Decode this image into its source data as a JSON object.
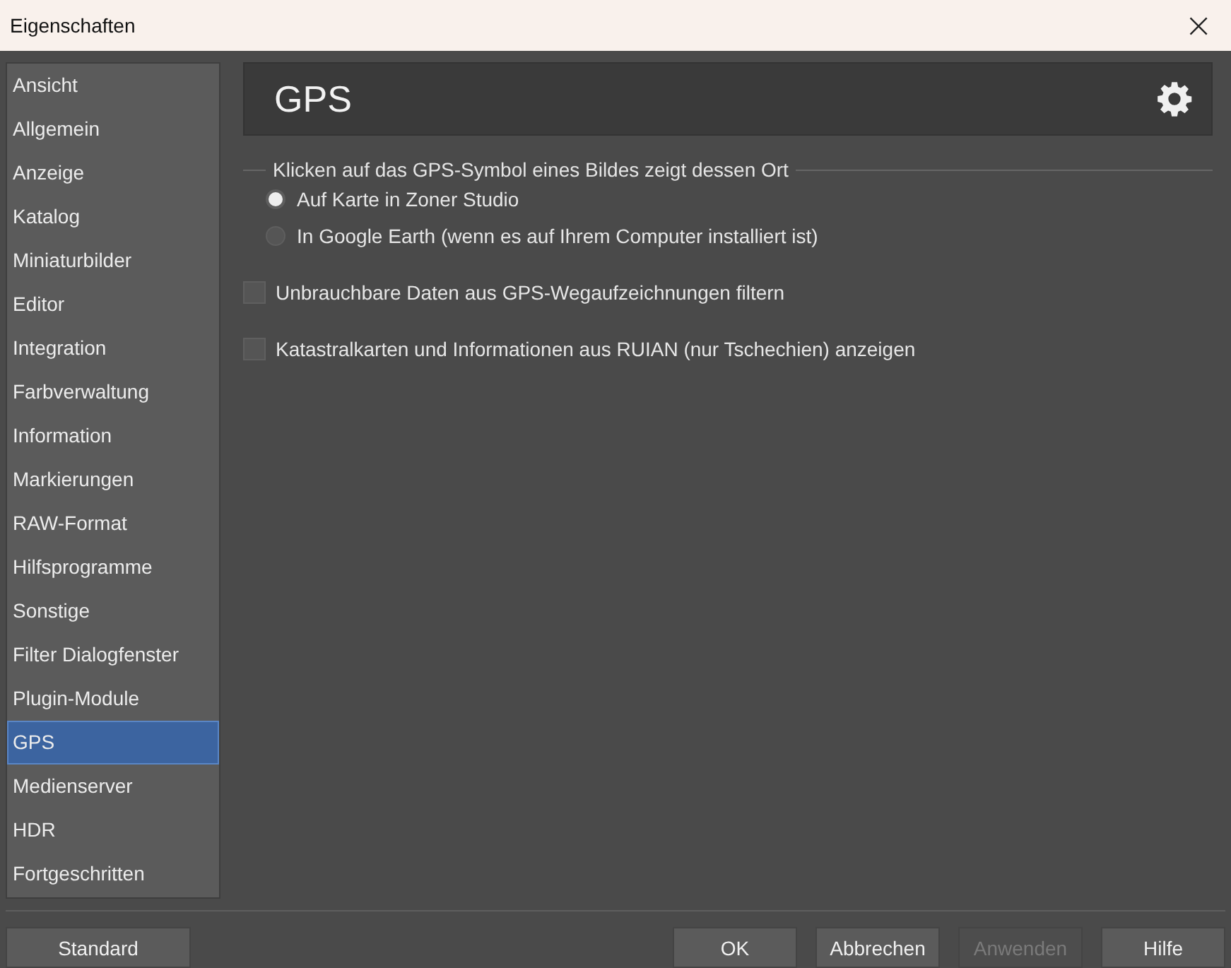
{
  "window": {
    "title": "Eigenschaften",
    "close": "×"
  },
  "sidebar": {
    "items": [
      {
        "label": "Ansicht",
        "selected": false
      },
      {
        "label": "Allgemein",
        "selected": false
      },
      {
        "label": "Anzeige",
        "selected": false
      },
      {
        "label": "Katalog",
        "selected": false
      },
      {
        "label": "Miniaturbilder",
        "selected": false
      },
      {
        "label": "Editor",
        "selected": false
      },
      {
        "label": "Integration",
        "selected": false
      },
      {
        "label": "Farbverwaltung",
        "selected": false
      },
      {
        "label": "Information",
        "selected": false
      },
      {
        "label": "Markierungen",
        "selected": false
      },
      {
        "label": "RAW-Format",
        "selected": false
      },
      {
        "label": "Hilfsprogramme",
        "selected": false
      },
      {
        "label": "Sonstige",
        "selected": false
      },
      {
        "label": "Filter Dialogfenster",
        "selected": false
      },
      {
        "label": "Plugin-Module",
        "selected": false
      },
      {
        "label": "GPS",
        "selected": true
      },
      {
        "label": "Medienserver",
        "selected": false
      },
      {
        "label": "HDR",
        "selected": false
      },
      {
        "label": "Fortgeschritten",
        "selected": false
      }
    ]
  },
  "page": {
    "title": "GPS",
    "group": {
      "title": "Klicken auf das GPS-Symbol eines Bildes zeigt dessen Ort",
      "options": [
        {
          "label": "Auf Karte in Zoner Studio",
          "selected": true
        },
        {
          "label": "In Google Earth (wenn es auf Ihrem Computer installiert ist)",
          "selected": false
        }
      ]
    },
    "checkboxes": [
      {
        "label": "Unbrauchbare Daten aus GPS-Wegaufzeichnungen filtern",
        "checked": false
      },
      {
        "label": "Katastralkarten und Informationen aus RUIAN (nur Tschechien) anzeigen",
        "checked": false
      }
    ]
  },
  "footer": {
    "left_button": {
      "label": "Standard",
      "disabled": false
    },
    "buttons": [
      {
        "label": "OK",
        "disabled": false
      },
      {
        "label": "Abbrechen",
        "disabled": false
      },
      {
        "label": "Anwenden",
        "disabled": true
      },
      {
        "label": "Hilfe",
        "disabled": false
      }
    ]
  }
}
